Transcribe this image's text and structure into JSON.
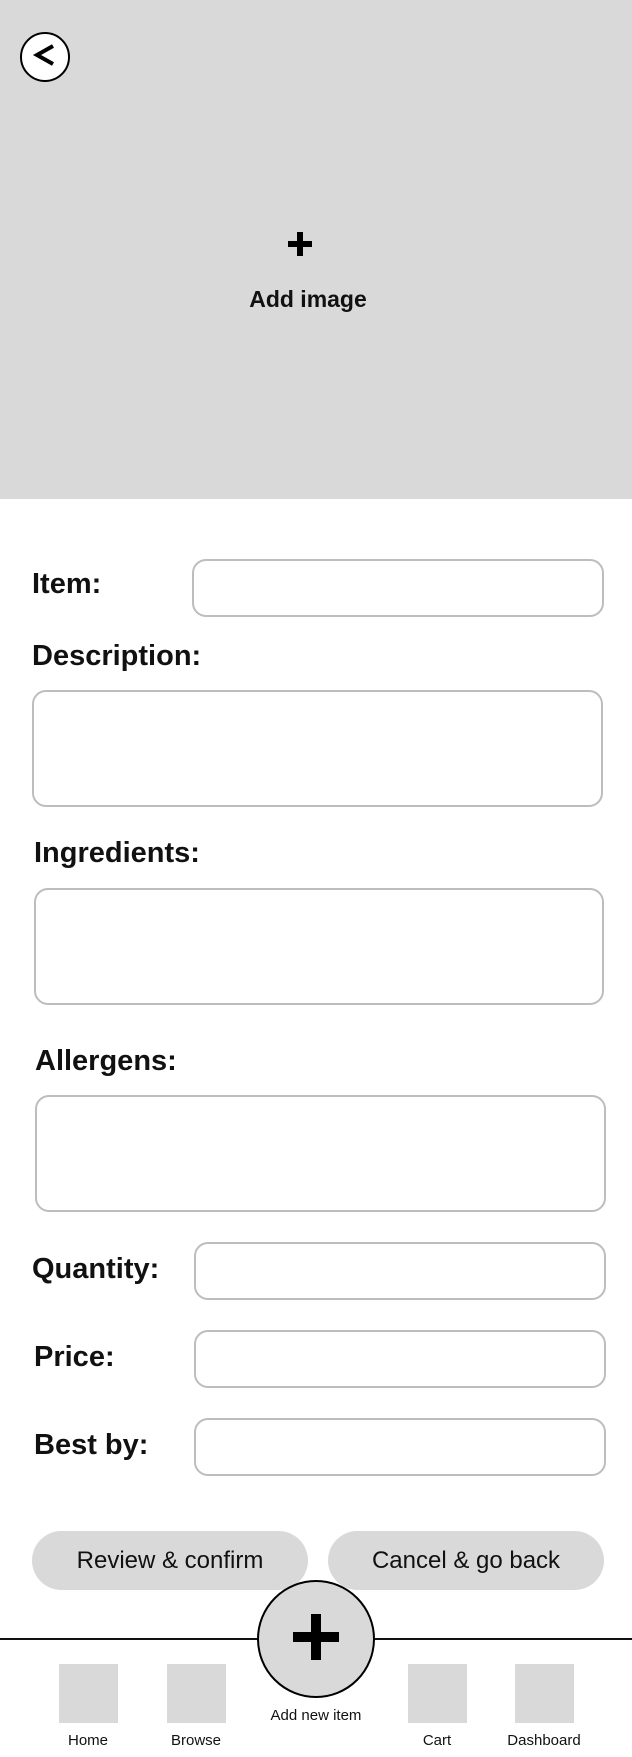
{
  "header": {
    "back_glyph": "<",
    "back_icon": "chevron-left-icon"
  },
  "hero": {
    "add_image_label": "Add image",
    "add_icon": "plus-icon",
    "background": "#d9d9d9"
  },
  "form": {
    "item": {
      "label": "Item:",
      "value": ""
    },
    "description": {
      "label": "Description:",
      "value": ""
    },
    "ingredients": {
      "label": "Ingredients:",
      "value": ""
    },
    "allergens": {
      "label": "Allergens:",
      "value": ""
    },
    "quantity": {
      "label": "Quantity:",
      "value": ""
    },
    "price": {
      "label": "Price:",
      "value": ""
    },
    "best_by": {
      "label": "Best by:",
      "value": ""
    }
  },
  "actions": {
    "review_label": "Review & confirm",
    "cancel_label": "Cancel & go back"
  },
  "bottom_nav": {
    "add_new_label": "Add new item",
    "add_icon": "plus-icon",
    "items": [
      {
        "label": "Home"
      },
      {
        "label": "Browse"
      },
      {
        "label": "Cart"
      },
      {
        "label": "Dashboard"
      }
    ]
  },
  "colors": {
    "placeholder_gray": "#d9d9d9",
    "field_border": "#bdbdbd",
    "text": "#111111"
  }
}
